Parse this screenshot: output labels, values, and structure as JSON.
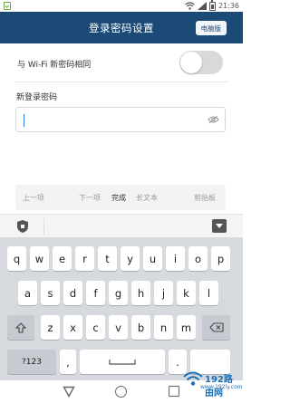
{
  "status_bar": {
    "time": "21:36"
  },
  "header": {
    "title": "登录密码设置",
    "pc_button": "电脑版"
  },
  "wifi_same": {
    "label": "与 Wi-Fi 新密码相同",
    "enabled": false
  },
  "password": {
    "label": "新登录密码",
    "value": ""
  },
  "form_toolbar": {
    "prev": "上一项",
    "next": "下一项",
    "done": "完成",
    "long_text": "长文本",
    "clipboard": "剪贴板"
  },
  "keyboard": {
    "row1": [
      "q",
      "w",
      "e",
      "r",
      "t",
      "y",
      "u",
      "i",
      "o",
      "p"
    ],
    "row2": [
      "a",
      "s",
      "d",
      "f",
      "g",
      "h",
      "j",
      "k",
      "l"
    ],
    "row3": [
      "z",
      "x",
      "c",
      "v",
      "b",
      "n",
      "m"
    ],
    "symbols_key": "?123",
    "comma_key": ",",
    "period_key": "."
  },
  "watermark": {
    "brand": "192路由网",
    "url": "www.192ly.com"
  },
  "colors": {
    "header": "#1a4a75",
    "keyboard_bg": "#d6d9de",
    "caret": "#2a7ae2"
  }
}
